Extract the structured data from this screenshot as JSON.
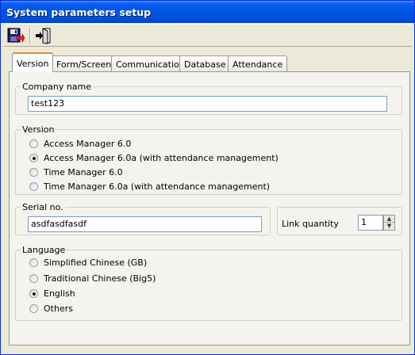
{
  "window": {
    "title": "System parameters setup"
  },
  "toolbar": {
    "save_icon": "save-icon",
    "exit_icon": "exit-icon"
  },
  "tabs": [
    {
      "label": "Version",
      "active": true
    },
    {
      "label": "Form/Screen",
      "active": false
    },
    {
      "label": "Communication",
      "active": false
    },
    {
      "label": "Database",
      "active": false
    },
    {
      "label": "Attendance",
      "active": false
    }
  ],
  "company": {
    "legend": "Company name",
    "value": "test123"
  },
  "version": {
    "legend": "Version",
    "options": [
      {
        "label": "Access Manager 6.0",
        "selected": false
      },
      {
        "label": "Access Manager 6.0a (with attendance management)",
        "selected": true
      },
      {
        "label": "Time Manager 6.0",
        "selected": false
      },
      {
        "label": "Time Manager 6.0a (with attendance management)",
        "selected": false
      }
    ]
  },
  "serial": {
    "legend": "Serial no.",
    "value": "asdfasdfasdf"
  },
  "link": {
    "label": "Link quantity",
    "value": "1"
  },
  "language": {
    "legend": "Language",
    "options": [
      {
        "label": "Simplified Chinese (GB)",
        "selected": false
      },
      {
        "label": "Traditional Chinese (Big5)",
        "selected": false
      },
      {
        "label": "English",
        "selected": true
      },
      {
        "label": "Others",
        "selected": false
      }
    ]
  },
  "colors": {
    "title_bar": "#0054e3",
    "tab_highlight": "#e68b2c",
    "face": "#ece9d8"
  }
}
